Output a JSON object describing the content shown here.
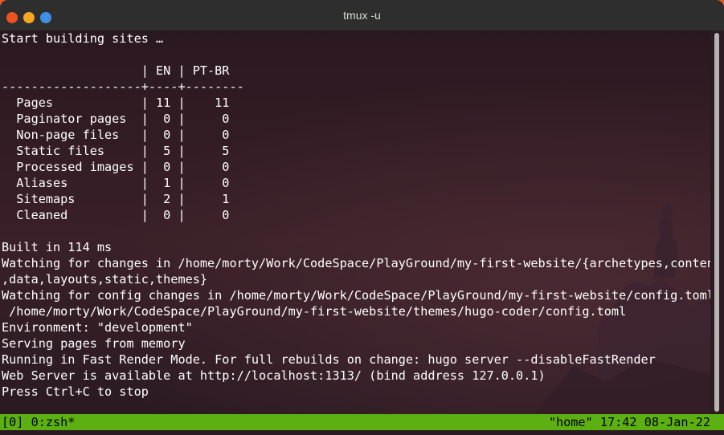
{
  "window": {
    "title": "tmux -u"
  },
  "terminal": {
    "lines": [
      "Start building sites …",
      "",
      "                   | EN | PT-BR",
      "-------------------+----+--------",
      "  Pages            | 11 |    11",
      "  Paginator pages  |  0 |     0",
      "  Non-page files   |  0 |     0",
      "  Static files     |  5 |     5",
      "  Processed images |  0 |     0",
      "  Aliases          |  1 |     0",
      "  Sitemaps         |  2 |     1",
      "  Cleaned          |  0 |     0",
      "",
      "Built in 114 ms",
      "Watching for changes in /home/morty/Work/CodeSpace/PlayGround/my-first-website/{archetypes,content",
      ",data,layouts,static,themes}",
      "Watching for config changes in /home/morty/Work/CodeSpace/PlayGround/my-first-website/config.toml,",
      " /home/morty/Work/CodeSpace/PlayGround/my-first-website/themes/hugo-coder/config.toml",
      "Environment: \"development\"",
      "Serving pages from memory",
      "Running in Fast Render Mode. For full rebuilds on change: hugo server --disableFastRender",
      "Web Server is available at http://localhost:1313/ (bind address 127.0.0.1)",
      "Press Ctrl+C to stop"
    ]
  },
  "statusbar": {
    "left": "[0] 0:zsh*",
    "right": "\"home\" 17:42 08-Jan-22"
  },
  "colors": {
    "accent": "#e95420",
    "status_bar": "#5cb011",
    "terminal_bg": "#2b1a22"
  }
}
